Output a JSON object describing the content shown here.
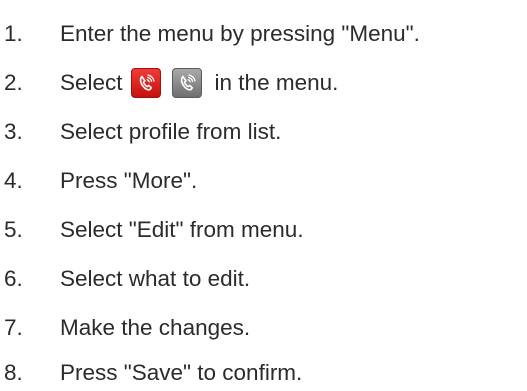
{
  "steps": [
    {
      "number": "1.",
      "text": "Enter the menu by pressing \"Menu\"."
    },
    {
      "number": "2.",
      "text_before": "Select",
      "icons": [
        "call-profile-red-icon",
        "call-profile-grey-icon"
      ],
      "text_after": "in the menu."
    },
    {
      "number": "3.",
      "text": "Select profile from list."
    },
    {
      "number": "4.",
      "text": "Press \"More\"."
    },
    {
      "number": "5.",
      "text": "Select \"Edit\" from menu."
    },
    {
      "number": "6.",
      "text": "Select what to edit."
    },
    {
      "number": "7.",
      "text": "Make the changes."
    },
    {
      "number": "8.",
      "text": "Press \"Save\" to confirm."
    }
  ],
  "colors": {
    "text": "#2b2b2b",
    "icon_red": "#e3201c",
    "icon_grey": "#8a8a8a"
  }
}
